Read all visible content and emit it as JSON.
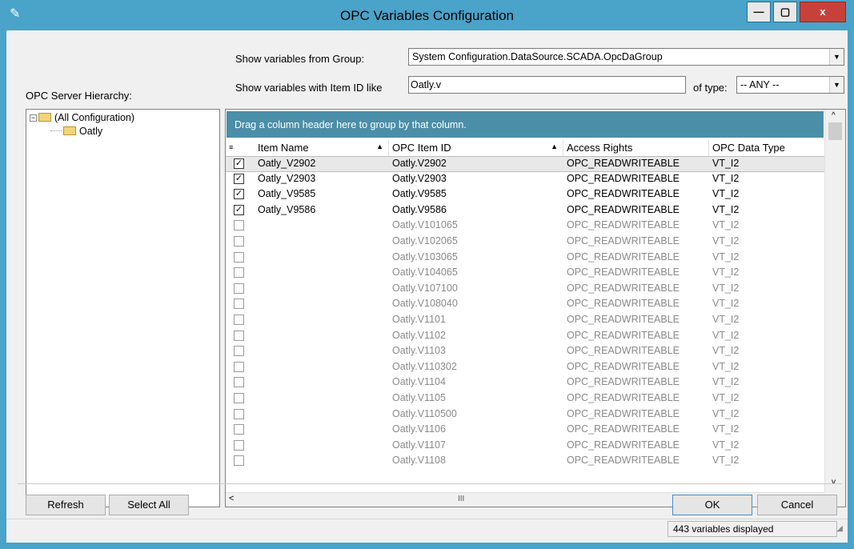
{
  "window": {
    "title": "OPC Variables Configuration",
    "minimize_label": "—",
    "maximize_label": "▢",
    "close_label": "x"
  },
  "filters": {
    "group_label": "Show variables from Group:",
    "group_value": "System Configuration.DataSource.SCADA.OpcDaGroup",
    "item_id_label": "Show variables with Item ID like",
    "item_id_value": "Oatly.v",
    "type_label": "of type:",
    "type_value": "-- ANY --"
  },
  "hierarchy": {
    "label": "OPC Server Hierarchy:",
    "root": "(All Configuration)",
    "child": "Oatly"
  },
  "grid": {
    "group_panel_text": "Drag a column header here to group by that column.",
    "columns": [
      "Item Name",
      "OPC Item ID",
      "Access Rights",
      "OPC Data Type"
    ],
    "rows": [
      {
        "checked": true,
        "name": "Oatly_V2902",
        "id": "Oatly.V2902",
        "rights": "OPC_READWRITEABLE",
        "type": "VT_I2"
      },
      {
        "checked": true,
        "name": "Oatly_V2903",
        "id": "Oatly.V2903",
        "rights": "OPC_READWRITEABLE",
        "type": "VT_I2"
      },
      {
        "checked": true,
        "name": "Oatly_V9585",
        "id": "Oatly.V9585",
        "rights": "OPC_READWRITEABLE",
        "type": "VT_I2"
      },
      {
        "checked": true,
        "name": "Oatly_V9586",
        "id": "Oatly.V9586",
        "rights": "OPC_READWRITEABLE",
        "type": "VT_I2"
      },
      {
        "checked": false,
        "name": "",
        "id": "Oatly.V101065",
        "rights": "OPC_READWRITEABLE",
        "type": "VT_I2"
      },
      {
        "checked": false,
        "name": "",
        "id": "Oatly.V102065",
        "rights": "OPC_READWRITEABLE",
        "type": "VT_I2"
      },
      {
        "checked": false,
        "name": "",
        "id": "Oatly.V103065",
        "rights": "OPC_READWRITEABLE",
        "type": "VT_I2"
      },
      {
        "checked": false,
        "name": "",
        "id": "Oatly.V104065",
        "rights": "OPC_READWRITEABLE",
        "type": "VT_I2"
      },
      {
        "checked": false,
        "name": "",
        "id": "Oatly.V107100",
        "rights": "OPC_READWRITEABLE",
        "type": "VT_I2"
      },
      {
        "checked": false,
        "name": "",
        "id": "Oatly.V108040",
        "rights": "OPC_READWRITEABLE",
        "type": "VT_I2"
      },
      {
        "checked": false,
        "name": "",
        "id": "Oatly.V1101",
        "rights": "OPC_READWRITEABLE",
        "type": "VT_I2"
      },
      {
        "checked": false,
        "name": "",
        "id": "Oatly.V1102",
        "rights": "OPC_READWRITEABLE",
        "type": "VT_I2"
      },
      {
        "checked": false,
        "name": "",
        "id": "Oatly.V1103",
        "rights": "OPC_READWRITEABLE",
        "type": "VT_I2"
      },
      {
        "checked": false,
        "name": "",
        "id": "Oatly.V110302",
        "rights": "OPC_READWRITEABLE",
        "type": "VT_I2"
      },
      {
        "checked": false,
        "name": "",
        "id": "Oatly.V1104",
        "rights": "OPC_READWRITEABLE",
        "type": "VT_I2"
      },
      {
        "checked": false,
        "name": "",
        "id": "Oatly.V1105",
        "rights": "OPC_READWRITEABLE",
        "type": "VT_I2"
      },
      {
        "checked": false,
        "name": "",
        "id": "Oatly.V110500",
        "rights": "OPC_READWRITEABLE",
        "type": "VT_I2"
      },
      {
        "checked": false,
        "name": "",
        "id": "Oatly.V1106",
        "rights": "OPC_READWRITEABLE",
        "type": "VT_I2"
      },
      {
        "checked": false,
        "name": "",
        "id": "Oatly.V1107",
        "rights": "OPC_READWRITEABLE",
        "type": "VT_I2"
      },
      {
        "checked": false,
        "name": "",
        "id": "Oatly.V1108",
        "rights": "OPC_READWRITEABLE",
        "type": "VT_I2"
      }
    ],
    "hscroll_thumb": "III"
  },
  "buttons": {
    "refresh": "Refresh",
    "select_all": "Select All",
    "ok": "OK",
    "cancel": "Cancel"
  },
  "status": {
    "count_text": "443 variables displayed"
  },
  "colors": {
    "chrome": "#4aa3c9",
    "group_panel": "#4a8ea8",
    "close_button": "#c7413a"
  }
}
